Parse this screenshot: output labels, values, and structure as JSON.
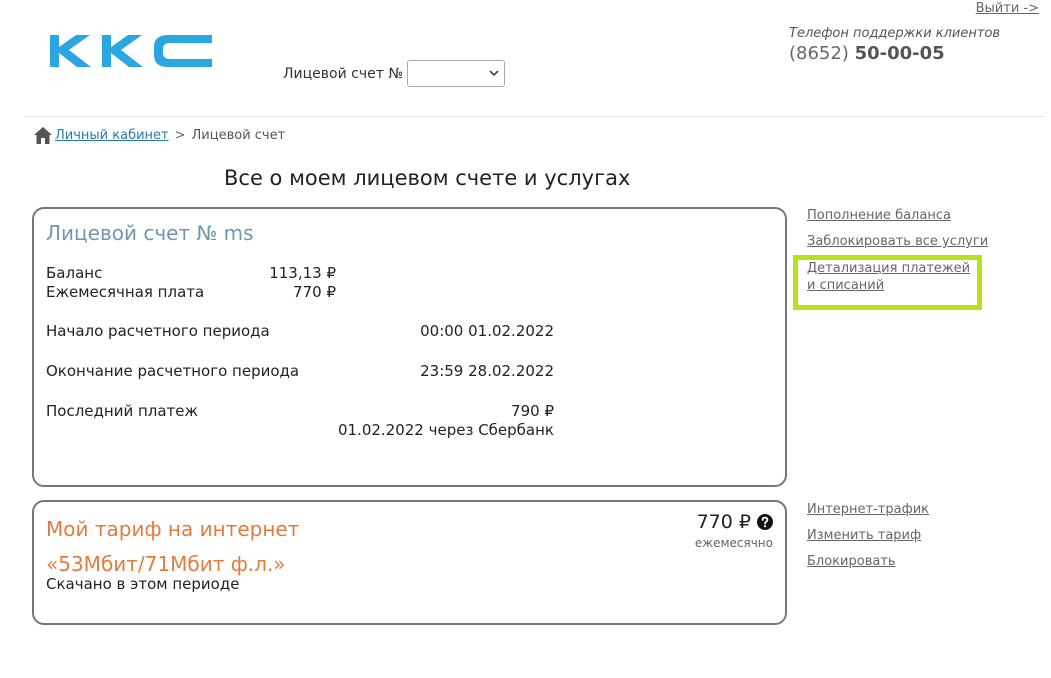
{
  "header": {
    "logout_label": "Выйти ->",
    "logo_text": "ККС",
    "account_select_label": "Лицевой счет №",
    "support_label": "Телефон поддержки клиентов",
    "support_code": "(8652)",
    "support_number": "50-00-05"
  },
  "breadcrumb": {
    "home_label": "Личный кабинет",
    "separator": ">",
    "current": "Лицевой счет"
  },
  "page_title": "Все о моем лицевом счете и услугах",
  "account_card": {
    "heading": "Лицевой счет № ms",
    "balance_label": "Баланс",
    "balance_value": "113,13 ₽",
    "monthly_label": "Ежемесячная плата",
    "monthly_value": "770 ₽",
    "period_start_label": "Начало расчетного периода",
    "period_start_value": "00:00 01.02.2022",
    "period_end_label": "Окончание расчетного периода",
    "period_end_value": "23:59 28.02.2022",
    "last_payment_label": "Последний платеж",
    "last_payment_amount": "790 ₽",
    "last_payment_details": "01.02.2022 через Сбербанк"
  },
  "account_links": [
    {
      "label": "Пополнение баланса"
    },
    {
      "label": "Заблокировать все услуги"
    },
    {
      "label_line1": "Детализация платежей",
      "label_line2": "и списаний"
    }
  ],
  "tariff_card": {
    "title_line1": "Мой тариф на интернет",
    "title_line2": "«53Мбит/71Мбит ф.л.»",
    "downloaded_label": "Скачано в этом периоде",
    "price": "770 ₽",
    "period": "ежемесячно"
  },
  "tariff_links": [
    {
      "label": "Интернет-трафик"
    },
    {
      "label": "Изменить тариф"
    },
    {
      "label": "Блокировать"
    }
  ],
  "colors": {
    "logo": "#2aa7e1",
    "account_heading": "#6e97b0",
    "tariff_title": "#e27c3c",
    "highlight": "#b5e21a",
    "breadcrumb_link": "#2c7aa8"
  }
}
